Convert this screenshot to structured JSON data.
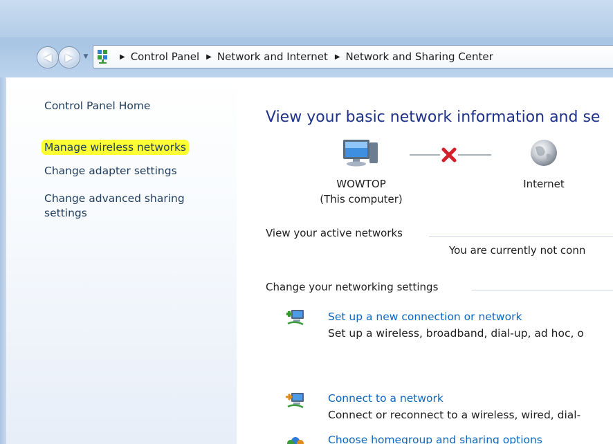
{
  "breadcrumb": {
    "items": [
      "Control Panel",
      "Network and Internet",
      "Network and Sharing Center"
    ]
  },
  "left_pane": {
    "home_link": "Control Panel Home",
    "links": [
      "Manage wireless networks",
      "Change adapter settings",
      "Change advanced sharing",
      "settings"
    ]
  },
  "main": {
    "title": "View your basic network information and se",
    "network_map": {
      "computer_name": "WOWTOP",
      "computer_caption": "(This computer)",
      "internet_label": "Internet",
      "connection_status_icon": "x-icon"
    },
    "active_networks": {
      "header": "View your active networks",
      "status_text": "You are currently not conn"
    },
    "networking_settings": {
      "header": "Change your networking settings",
      "tasks": [
        {
          "link": "Set up a new connection or network",
          "description": "Set up a wireless, broadband, dial-up, ad hoc, o"
        },
        {
          "link": "Connect to a network",
          "description": "Connect or reconnect to a wireless, wired, dial-"
        },
        {
          "link": "Choose homegroup and sharing options",
          "description": ""
        }
      ]
    }
  },
  "colors": {
    "highlight": "#fbff33",
    "link": "#0b66c2",
    "title": "#1e3287",
    "error_x": "#d4202a"
  }
}
